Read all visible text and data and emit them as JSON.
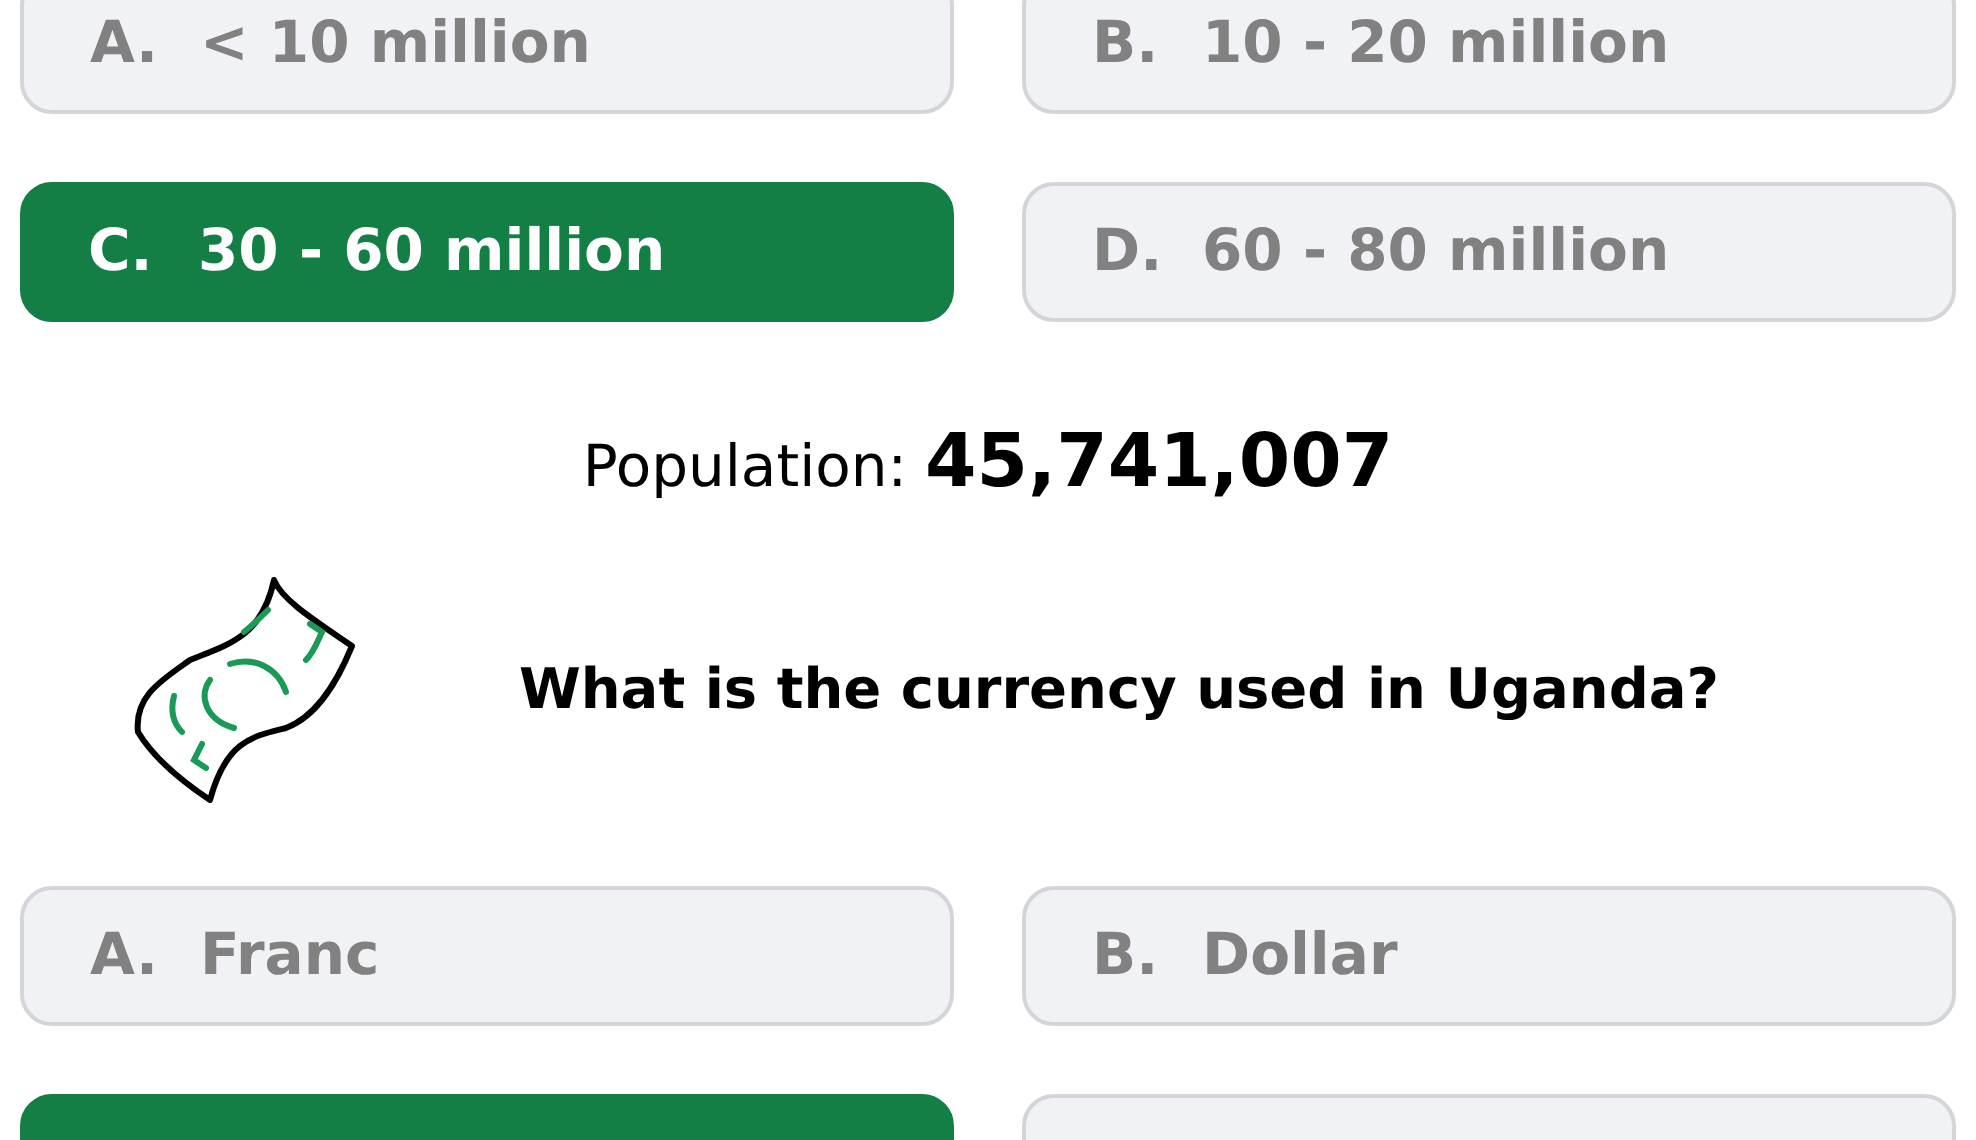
{
  "questions": [
    {
      "options": [
        {
          "letter": "A.",
          "text": "< 10 million",
          "selected": false
        },
        {
          "letter": "B.",
          "text": "10 - 20 million",
          "selected": false
        },
        {
          "letter": "C.",
          "text": "30 - 60 million",
          "selected": true
        },
        {
          "letter": "D.",
          "text": "60 - 80 million",
          "selected": false
        }
      ],
      "answer": {
        "label": "Population:",
        "value": "45,741,007"
      }
    },
    {
      "prompt": "What is the currency used in Uganda?",
      "options": [
        {
          "letter": "A.",
          "text": "Franc",
          "selected": false
        },
        {
          "letter": "B.",
          "text": "Dollar",
          "selected": false
        },
        {
          "selected": true
        },
        {
          "selected": false
        }
      ]
    }
  ]
}
